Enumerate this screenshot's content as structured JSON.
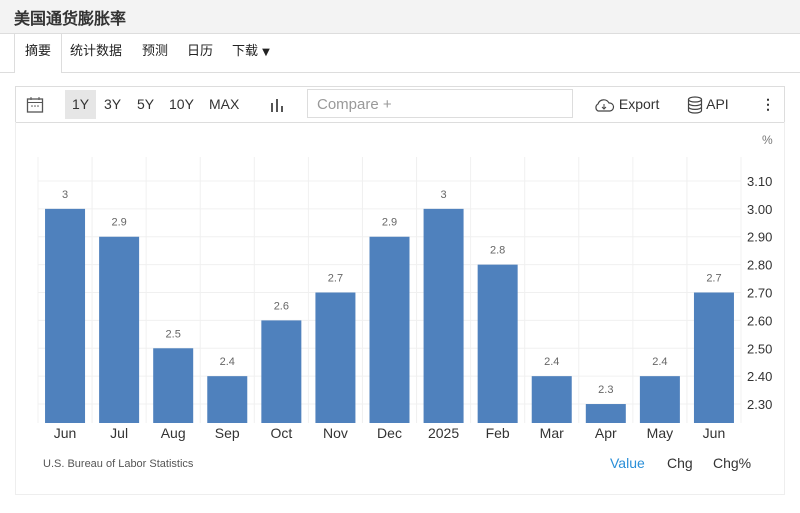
{
  "title": "美国通货膨胀率",
  "tabs": [
    "摘要",
    "统计数据",
    "预测",
    "日历",
    "下载"
  ],
  "toolbar": {
    "ranges": [
      "1Y",
      "3Y",
      "5Y",
      "10Y",
      "MAX"
    ],
    "active_range": "1Y",
    "compare_placeholder": "Compare +",
    "export": "Export",
    "api": "API"
  },
  "chart_data": {
    "type": "bar",
    "categories": [
      "Jun",
      "Jul",
      "Aug",
      "Sep",
      "Oct",
      "Nov",
      "Dec",
      "2025",
      "Feb",
      "Mar",
      "Apr",
      "May",
      "Jun"
    ],
    "values": [
      3,
      2.9,
      2.5,
      2.4,
      2.6,
      2.7,
      2.9,
      3,
      2.8,
      2.4,
      2.3,
      2.4,
      2.7
    ],
    "unit": "%",
    "ylim": [
      2.232,
      3.186
    ],
    "yticks": [
      "3.10",
      "3.00",
      "2.90",
      "2.80",
      "2.70",
      "2.60",
      "2.50",
      "2.40",
      "2.30"
    ],
    "bar_color": "#4f81bd",
    "grid": true
  },
  "footer": {
    "source": "U.S. Bureau of Labor Statistics",
    "modes": [
      "Value",
      "Chg",
      "Chg%"
    ],
    "active_mode": "Value",
    "active_color": "#2a8fd8"
  }
}
